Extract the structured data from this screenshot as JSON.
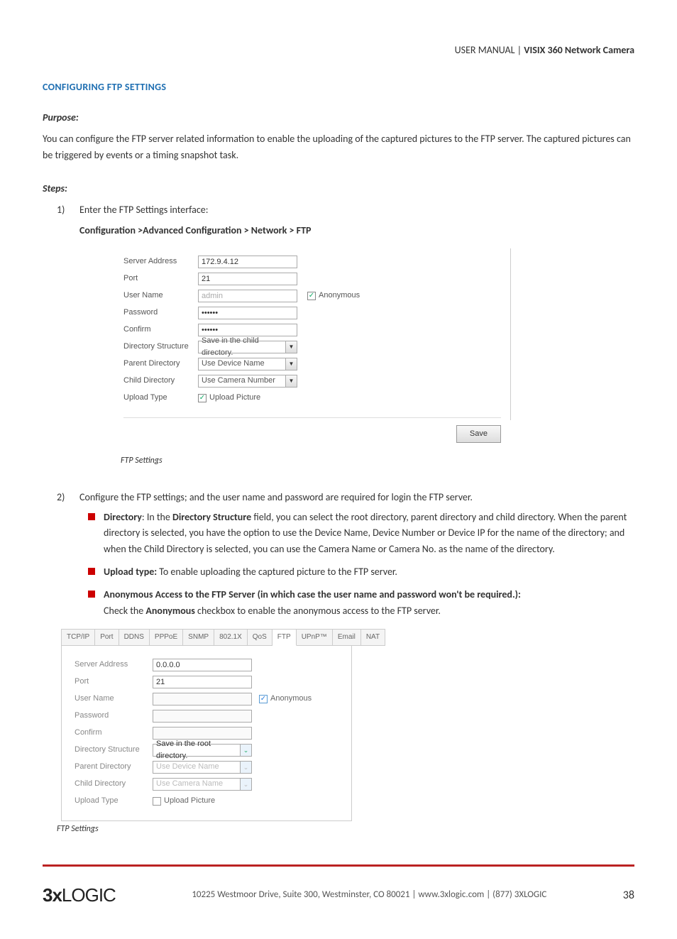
{
  "header": {
    "left": "USER MANUAL | ",
    "product": "VISIX 360 Network Camera"
  },
  "section_title": "CONFIGURING FTP SETTINGS",
  "purpose": {
    "label": "Purpose:",
    "text": "You can configure the FTP server related information to enable the uploading of the captured pictures to the FTP server. The captured pictures can be triggered by events or a timing snapshot task."
  },
  "steps_label": "Steps:",
  "step1": {
    "num": "1)",
    "text": "Enter the FTP Settings interface:",
    "nav": "Configuration >Advanced Configuration > Network > FTP"
  },
  "shot1": {
    "rows": {
      "server_address": {
        "label": "Server Address",
        "value": "172.9.4.12"
      },
      "port": {
        "label": "Port",
        "value": "21"
      },
      "user_name": {
        "label": "User Name",
        "value": "admin"
      },
      "anonymous": {
        "label": "Anonymous",
        "checked": "✓"
      },
      "password": {
        "label": "Password",
        "value": "••••••"
      },
      "confirm": {
        "label": "Confirm",
        "value": "••••••"
      },
      "dir_struct": {
        "label": "Directory Structure",
        "value": "Save in the child directory."
      },
      "parent_dir": {
        "label": "Parent Directory",
        "value": "Use Device Name"
      },
      "child_dir": {
        "label": "Child Directory",
        "value": "Use Camera Number"
      },
      "upload_type": {
        "label": "Upload Type",
        "option": "Upload Picture",
        "checked": "✓"
      }
    },
    "save": "Save",
    "caption": "FTP Settings"
  },
  "step2": {
    "num": "2)",
    "text": "Configure the FTP settings; and the user name and password are required for login the FTP server.",
    "bullets": [
      {
        "strong1": "Directory",
        "mid": ": In the ",
        "strong2": "Directory Structure",
        "rest": " field, you can select the root directory, parent directory and child directory. When the parent directory is selected, you have the option to use the Device Name, Device Number or Device IP for the name of the directory; and when the Child Directory is selected, you can use the Camera Name or Camera No. as the name of the directory."
      },
      {
        "strong1": "Upload type:",
        "rest": " To enable uploading the captured picture to the FTP server."
      },
      {
        "strong1": "Anonymous Access to the FTP Server (in which case the user name and password won't be required.):",
        "rest_pre": "Check the ",
        "strong2": "Anonymous",
        "rest": " checkbox to enable the anonymous access to the FTP server."
      }
    ]
  },
  "shot2": {
    "tabs": [
      "TCP/IP",
      "Port",
      "DDNS",
      "PPPoE",
      "SNMP",
      "802.1X",
      "QoS",
      "FTP",
      "UPnP™",
      "Email",
      "NAT"
    ],
    "active_tab_index": 7,
    "rows": {
      "server_address": {
        "label": "Server Address",
        "value": "0.0.0.0"
      },
      "port": {
        "label": "Port",
        "value": "21"
      },
      "user_name": {
        "label": "User Name",
        "value": ""
      },
      "anonymous": {
        "label": "Anonymous",
        "checked": "✓"
      },
      "password": {
        "label": "Password",
        "value": ""
      },
      "confirm": {
        "label": "Confirm",
        "value": ""
      },
      "dir_struct": {
        "label": "Directory Structure",
        "value": "Save in the root directory."
      },
      "parent_dir": {
        "label": "Parent Directory",
        "value": "Use Device Name"
      },
      "child_dir": {
        "label": "Child Directory",
        "value": "Use Camera Name"
      },
      "upload_type": {
        "label": "Upload Type",
        "option": "Upload Picture"
      }
    },
    "caption": "FTP Settings"
  },
  "footer": {
    "logo": "3xLOGIC",
    "address": "10225 Westmoor Drive, Suite 300, Westminster, CO 80021 | www.3xlogic.com | (877) 3XLOGIC",
    "page": "38"
  }
}
